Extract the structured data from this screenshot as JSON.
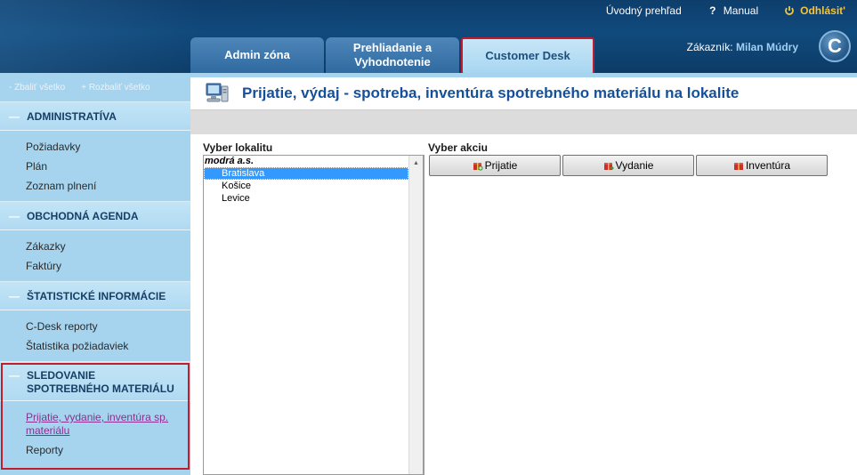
{
  "topbar": {
    "home": "Úvodný prehľad",
    "manual": "Manual",
    "logout": "Odhlásit'"
  },
  "tabs": [
    {
      "label": "Admin zóna"
    },
    {
      "label": "Prehliadanie a Vyhodnotenie"
    },
    {
      "label": "Customer Desk"
    }
  ],
  "customer": {
    "label": "Zákazník:",
    "name": "Milan Múdry"
  },
  "logo_letter": "C",
  "sidebar": {
    "collapse_all": "- Zbaliť všetko",
    "expand_all": "+ Rozbaliť všetko",
    "sections": [
      {
        "title": "ADMINISTRATÍVA",
        "items": [
          "Požiadavky",
          "Plán",
          "Zoznam plnení"
        ]
      },
      {
        "title": "OBCHODNÁ AGENDA",
        "items": [
          "Zákazky",
          "Faktúry"
        ]
      },
      {
        "title": "ŠTATISTICKÉ INFORMÁCIE",
        "items": [
          "C-Desk reporty",
          "Štatistika požiadaviek"
        ]
      },
      {
        "title": "SLEDOVANIE SPOTREBNÉHO MATERIÁLU",
        "items": [
          "Prijatie, vydanie, inventúra sp. materiálu",
          "Reporty"
        ]
      }
    ]
  },
  "main": {
    "title": "Prijatie, výdaj - spotreba, inventúra spotrebného materiálu na lokalite",
    "location_label": "Vyber lokalitu",
    "action_label": "Vyber akciu",
    "location_group": "modrá a.s.",
    "locations": [
      "Bratislava",
      "Košice",
      "Levice"
    ],
    "selected_location": "Bratislava",
    "actions": [
      "Prijatie",
      "Vydanie",
      "Inventúra"
    ]
  },
  "colors": {
    "header": "#104a7d",
    "accent_blue": "#15509a",
    "highlight_red": "#c21d2f",
    "sidebar_bg": "#a6d4ef",
    "logout": "#f5c53a"
  }
}
